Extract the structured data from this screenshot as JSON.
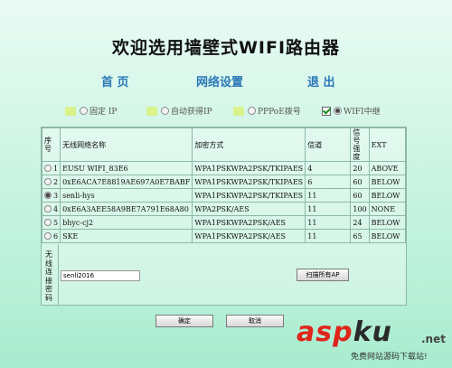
{
  "page_title": "欢迎选用墙壁式WIFI路由器",
  "nav": {
    "home": "首  页",
    "network": "网络设置",
    "exit": "退  出"
  },
  "modes": [
    {
      "label": "固定 IP",
      "selected": false
    },
    {
      "label": "自动获得IP",
      "selected": false
    },
    {
      "label": "PPPoE拨号",
      "selected": false
    },
    {
      "label": "WIFI中继",
      "selected": true
    }
  ],
  "table": {
    "headers": [
      "序号",
      "无线网络名称",
      "加密方式",
      "信道",
      "信号强度",
      "EXT"
    ],
    "rows": [
      {
        "index": "1",
        "ssid": "EUSU WIFI_83E6",
        "encryption": "WPA1PSKWPA2PSK/TKIPAES",
        "channel": "4",
        "signal": "20",
        "ext": "ABOVE",
        "selected": false
      },
      {
        "index": "2",
        "ssid": "0xE6ACA7E8819AE697A0E7BABF",
        "encryption": "WPA1PSKWPA2PSK/TKIPAES",
        "channel": "6",
        "signal": "60",
        "ext": "BELOW",
        "selected": false
      },
      {
        "index": "3",
        "ssid": "senli-hys",
        "encryption": "WPA1PSKWPA2PSK/TKIPAES",
        "channel": "11",
        "signal": "60",
        "ext": "BELOW",
        "selected": true
      },
      {
        "index": "4",
        "ssid": "0xE6A3AEE58A9BE7A791E68A80",
        "encryption": "WPA2PSK/AES",
        "channel": "11",
        "signal": "100",
        "ext": "NONE",
        "selected": false
      },
      {
        "index": "5",
        "ssid": "bhyc-cj2",
        "encryption": "WPA1PSKWPA2PSK/AES",
        "channel": "11",
        "signal": "24",
        "ext": "BELOW",
        "selected": false
      },
      {
        "index": "6",
        "ssid": "SKE",
        "encryption": "WPA1PSKWPA2PSK/AES",
        "channel": "11",
        "signal": "65",
        "ext": "BELOW",
        "selected": false
      }
    ]
  },
  "password": {
    "label": "无线连接密码",
    "value": "senli2016"
  },
  "buttons": {
    "scan": "扫描所有AP",
    "confirm": "确定",
    "cancel": "取消"
  },
  "watermark": {
    "brand_a": "asp",
    "brand_b": "ku",
    "net": ".net",
    "slogan": "免费网站源码下载站!"
  }
}
